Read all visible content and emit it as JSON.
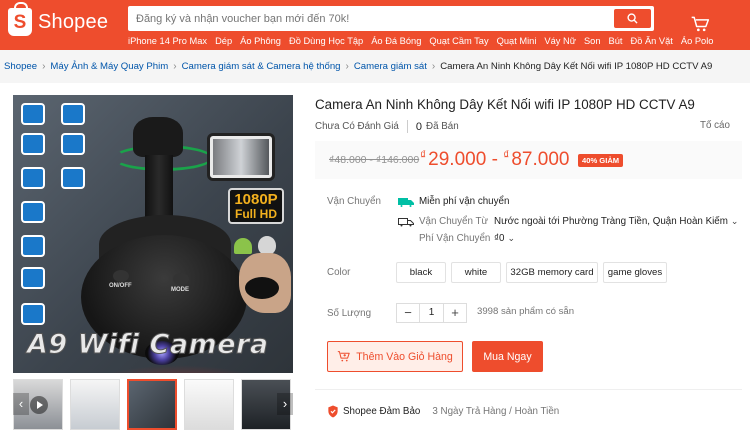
{
  "header": {
    "brand": "Shopee",
    "search_placeholder": "Đăng ký và nhận voucher bạn mới đến 70k!",
    "suggestions": [
      "iPhone 14 Pro Max",
      "Dép",
      "Áo Phông",
      "Đồ Dùng Học Tập",
      "Áo Đá Bóng",
      "Quạt Cầm Tay",
      "Quạt Mini",
      "Váy Nữ",
      "Son",
      "Bút",
      "Đồ Ăn Vặt",
      "Áo Polo"
    ]
  },
  "breadcrumb": {
    "items": [
      "Shopee",
      "Máy Ảnh & Máy Quay Phim",
      "Camera giám sát & Camera hệ thống",
      "Camera giám sát"
    ],
    "current": "Camera An Ninh Không Dây Kết Nối wifi IP 1080P HD CCTV A9"
  },
  "gallery": {
    "image_text": "A9 Wifi Camera",
    "badge_line1": "1080P",
    "badge_line2": "Full HD",
    "cam_label_on": "ON/OFF",
    "cam_label_mode": "MODE",
    "prev_icon": "‹",
    "next_icon": "›"
  },
  "product": {
    "title": "Camera An Ninh Không Dây Kết Nối wifi IP 1080P HD CCTV A9",
    "rating_text": "Chưa Có Đánh Giá",
    "sold_count": "0",
    "sold_label": "Đã Bán",
    "report": "Tố cáo",
    "old_price": "₫48.000 - ₫146.000",
    "price_currency": "₫",
    "price_low": "29.000",
    "price_sep": " - ",
    "price_currency2": "₫",
    "price_high": "87.000",
    "discount": "40% GIẢM"
  },
  "shipping": {
    "label": "Vận Chuyển",
    "free_ship": "Miễn phí vận chuyển",
    "from_label": "Vận Chuyển Từ",
    "from_value": "Nước ngoài tới Phường Tràng Tiền, Quận Hoàn Kiếm",
    "fee_label": "Phí Vận Chuyển",
    "fee_value": "₫0"
  },
  "variants": {
    "label": "Color",
    "options": [
      "black",
      "white",
      "32GB memory card",
      "game gloves"
    ]
  },
  "quantity": {
    "label": "Số Lượng",
    "minus": "−",
    "value": "1",
    "plus": "+",
    "stock": "3998 sản phẩm có sẵn"
  },
  "actions": {
    "add_to_cart": "Thêm Vào Giỏ Hàng",
    "buy_now": "Mua Ngay"
  },
  "guarantee": {
    "title": "Shopee Đảm Bảo",
    "desc": "3 Ngày Trả Hàng / Hoàn Tiền"
  },
  "colors": {
    "brand": "#ee4d2d",
    "link": "#0055aa"
  }
}
